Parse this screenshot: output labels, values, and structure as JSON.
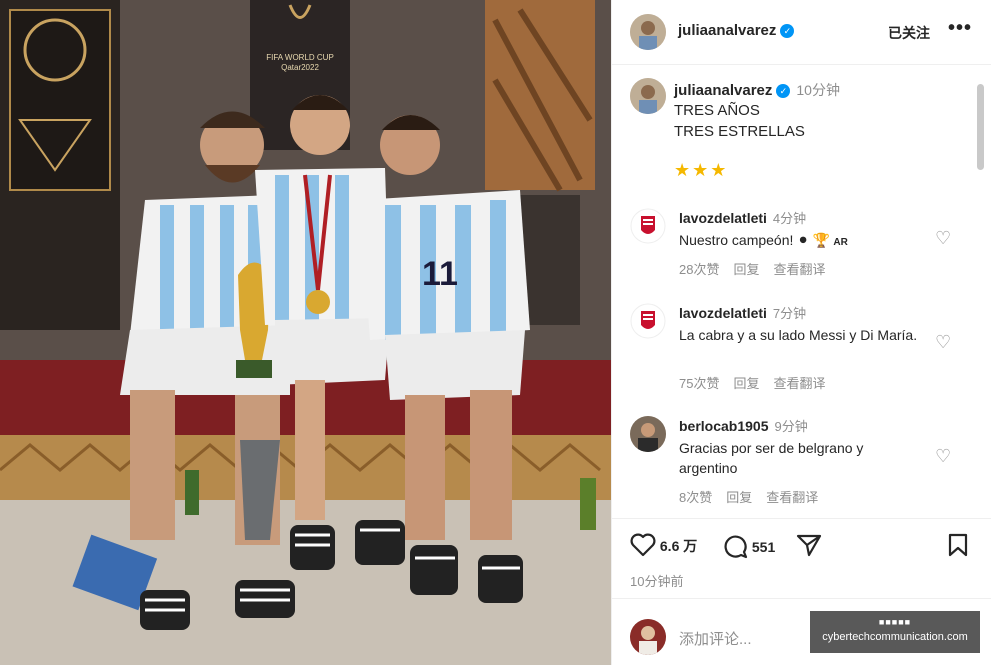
{
  "header": {
    "username": "juliaanalvarez",
    "follow_status": "已关注",
    "more": "•••"
  },
  "caption": {
    "username": "juliaanalvarez",
    "time": "10分钟",
    "text": "TRES AÑOS\nTRES ESTRELLAS",
    "stars": "★★★"
  },
  "comments": [
    {
      "username": "lavozdelatleti",
      "time": "4分钟",
      "text": "Nuestro campeón!",
      "badge": "AR",
      "likes": "28次赞",
      "reply": "回复",
      "translate": "查看翻译"
    },
    {
      "username": "lavozdelatleti",
      "time": "7分钟",
      "text": "La cabra y a su lado Messi y Di María.",
      "likes": "75次赞",
      "reply": "回复",
      "translate": "查看翻译"
    },
    {
      "username": "berlocab1905",
      "time": "9分钟",
      "text": "Gracias por ser de belgrano y argentino",
      "likes": "8次赞",
      "reply": "回复",
      "translate": "查看翻译"
    }
  ],
  "actions": {
    "likes_count": "6.6 万",
    "comments_count": "551",
    "post_time": "10分钟前"
  },
  "comment_box": {
    "placeholder": "添加评论..."
  },
  "watermark": {
    "line1": "■■■■■",
    "line2": "cybertechcommunication.com"
  },
  "photo": {
    "trophy_text": "FIFA WORLD CUP\nQatar2022",
    "jersey_number": "11"
  },
  "colors": {
    "verified": "#0095f6",
    "stars": "#f5b800",
    "muted_text": "#8e8e8e"
  }
}
